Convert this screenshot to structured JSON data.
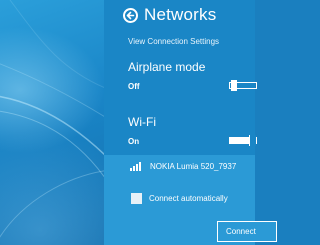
{
  "header": {
    "title": "Networks",
    "back_icon": "back-arrow-circle-icon"
  },
  "link": {
    "label": "View Connection Settings"
  },
  "airplane": {
    "title": "Airplane mode",
    "state": "Off"
  },
  "wifi": {
    "title": "Wi-Fi",
    "state": "On"
  },
  "network": {
    "name": "NOKIA Lumia 520_7937",
    "signal_icon": "wifi-signal-icon"
  },
  "auto_connect": {
    "label": "Connect automatically",
    "checked": false
  },
  "connect_button": {
    "label": "Connect"
  },
  "colors": {
    "panel": "#1a86c6",
    "panel_lower": "#2b9ad6",
    "desktop": "#1a86c8",
    "text": "#ffffff"
  }
}
